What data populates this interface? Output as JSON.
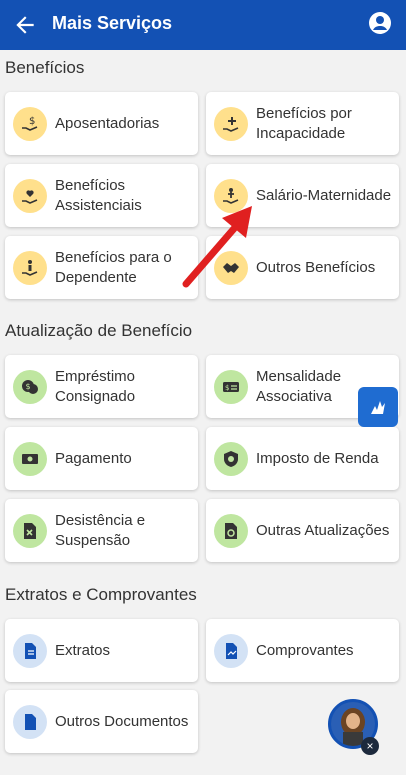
{
  "header": {
    "title": "Mais Serviços"
  },
  "sections": [
    {
      "title": "Benefícios"
    },
    {
      "title": "Atualização de Benefício"
    },
    {
      "title": "Extratos e Comprovantes"
    }
  ],
  "cards": {
    "aposentadorias": "Aposentadorias",
    "beneficios_incapacidade": "Benefícios por Incapacidade",
    "beneficios_assistenciais": "Benefícios Assistenciais",
    "salario_maternidade": "Salário-Maternidade",
    "beneficios_dependente": "Benefícios para o Dependente",
    "outros_beneficios": "Outros Benefícios",
    "emprestimo": "Empréstimo Consignado",
    "mensalidade": "Mensalidade Associativa",
    "pagamento": "Pagamento",
    "imposto": "Imposto de Renda",
    "desistencia": "Desistência e Suspensão",
    "outras_atualizacoes": "Outras Atualizações",
    "extratos": "Extratos",
    "comprovantes": "Comprovantes",
    "outros_documentos": "Outros Documentos"
  },
  "avatar_close": "×",
  "colors": {
    "primary": "#1351b4",
    "yellow": "#ffe08c",
    "green": "#bfe6a0",
    "blue": "#d3e2f5",
    "arrow": "#e02020"
  }
}
